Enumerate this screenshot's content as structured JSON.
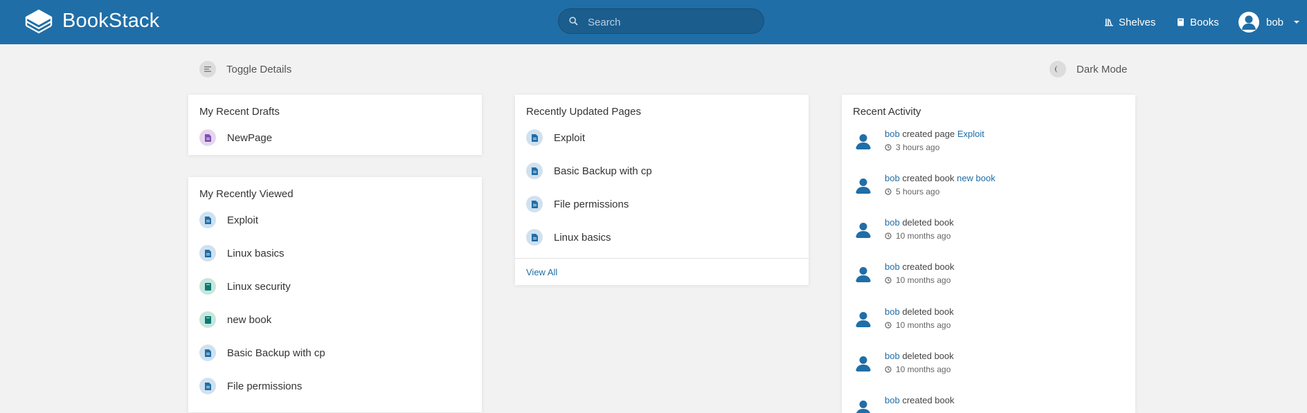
{
  "header": {
    "app_name": "BookStack",
    "search_placeholder": "Search",
    "nav": {
      "shelves": "Shelves",
      "books": "Books",
      "user": "bob"
    }
  },
  "actions": {
    "toggle_details": "Toggle Details",
    "dark_mode": "Dark Mode"
  },
  "drafts": {
    "title": "My Recent Drafts",
    "items": [
      {
        "label": "NewPage",
        "type": "draft"
      }
    ]
  },
  "recently_viewed": {
    "title": "My Recently Viewed",
    "items": [
      {
        "label": "Exploit",
        "type": "page"
      },
      {
        "label": "Linux basics",
        "type": "page"
      },
      {
        "label": "Linux security",
        "type": "book"
      },
      {
        "label": "new book",
        "type": "book"
      },
      {
        "label": "Basic Backup with cp",
        "type": "page"
      },
      {
        "label": "File permissions",
        "type": "page"
      }
    ]
  },
  "recently_updated": {
    "title": "Recently Updated Pages",
    "items": [
      {
        "label": "Exploit",
        "type": "page"
      },
      {
        "label": "Basic Backup with cp",
        "type": "page"
      },
      {
        "label": "File permissions",
        "type": "page"
      },
      {
        "label": "Linux basics",
        "type": "page"
      }
    ],
    "view_all": "View All"
  },
  "activity": {
    "title": "Recent Activity",
    "items": [
      {
        "user": "bob",
        "text": " created page ",
        "target": "Exploit",
        "time": "3 hours ago"
      },
      {
        "user": "bob",
        "text": " created book ",
        "target": "new book",
        "time": "5 hours ago"
      },
      {
        "user": "bob",
        "text": " deleted book",
        "target": "",
        "time": "10 months ago"
      },
      {
        "user": "bob",
        "text": " created book",
        "target": "",
        "time": "10 months ago"
      },
      {
        "user": "bob",
        "text": " deleted book",
        "target": "",
        "time": "10 months ago"
      },
      {
        "user": "bob",
        "text": " deleted book",
        "target": "",
        "time": "10 months ago"
      },
      {
        "user": "bob",
        "text": " created book",
        "target": "",
        "time": ""
      }
    ]
  },
  "colors": {
    "header_bg": "#206ea7",
    "link": "#206ea7",
    "page_icon": "#206ea7",
    "book_icon": "#077b70",
    "draft_icon": "#7e50b1"
  }
}
